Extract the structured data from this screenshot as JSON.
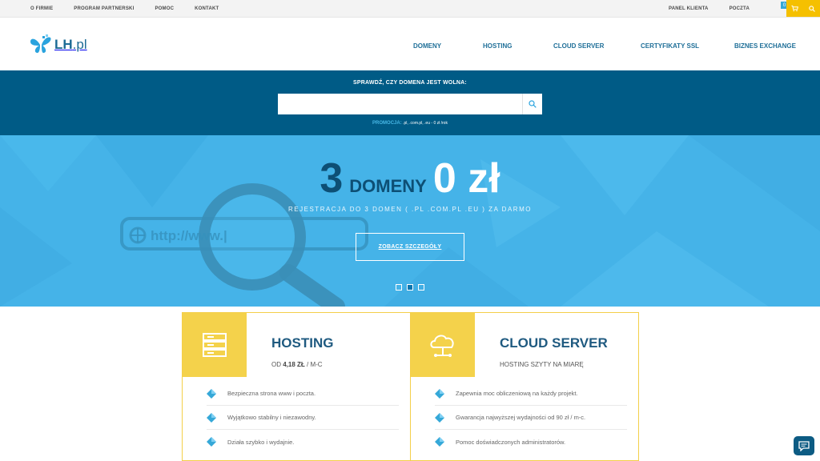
{
  "topbar": {
    "links": [
      "O FIRMIE",
      "PROGRAM PARTNERSKI",
      "POMOC",
      "KONTAKT"
    ],
    "right_links": [
      "PANEL KLIENTA",
      "POCZTA"
    ],
    "cart_count": "0",
    "cart_icon": "cart-icon",
    "search_icon": "search-icon"
  },
  "header": {
    "logo_text_main": "LH",
    "logo_text_suffix": ".pl",
    "nav": [
      "DOMENY",
      "HOSTING",
      "CLOUD SERVER",
      "CERTYFIKATY SSL",
      "BIZNES EXCHANGE"
    ]
  },
  "domain_search": {
    "title": "SPRAWDŹ, CZY DOMENA JEST WOLNA:",
    "input_value": "",
    "placeholder": "",
    "promo_label": "PROMOCJA:",
    "promo_text": ".pl, .com.pl, .eu - 0 zł /rok"
  },
  "hero": {
    "number_left": "3",
    "word": "DOMENY",
    "number_right": "0 zł",
    "subtitle": "REJESTRACJA DO 3 DOMEN ( .PL .COM.PL .EU ) ZA DARMO",
    "cta": "ZOBACZ SZCZEGÓŁY",
    "url_deco": "http://www.|",
    "slides": 3,
    "active_slide": 2
  },
  "cards": [
    {
      "title": "HOSTING",
      "sub_prefix": "OD ",
      "sub_strong": "4,18 ZŁ",
      "sub_suffix": " / M-C",
      "icon": "server-icon",
      "features": [
        "Bezpieczna strona www i poczta.",
        "Wyjątkowo stabilny i niezawodny.",
        "Działa szybko i wydajnie."
      ]
    },
    {
      "title": "CLOUD SERVER",
      "sub": "HOSTING SZYTY NA MIARĘ",
      "icon": "cloud-icon",
      "features": [
        "Zapewnia moc obliczeniową na każdy projekt.",
        "Gwarancja najwyższej wydajności od 90 zł / m-c.",
        "Pomoc doświadczonych administratorów."
      ]
    }
  ],
  "colors": {
    "topbar_accent": "#f5c000",
    "domain_band": "#005b86",
    "hero_bg": "#45b3e8",
    "brand_dark": "#1f5a80",
    "card_accent": "#f4d24b"
  }
}
